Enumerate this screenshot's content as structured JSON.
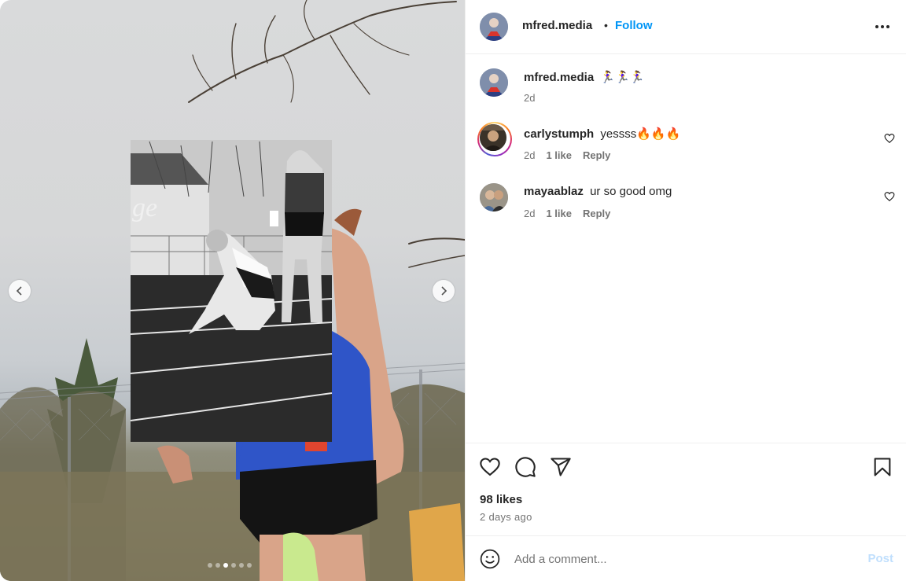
{
  "post": {
    "author": "mfred.media",
    "follow_label": "Follow",
    "separator": "•",
    "more_icon": "more-options-icon",
    "caption": {
      "username": "mfred.media",
      "text": "🏃‍♀️🏃‍♀️🏃‍♀️",
      "time": "2d"
    },
    "comments": [
      {
        "username": "carlystumph",
        "text": "yessss🔥🔥🔥",
        "time": "2d",
        "likes": "1 like",
        "reply": "Reply",
        "has_story": true
      },
      {
        "username": "mayaablaz",
        "text": "ur so good omg",
        "time": "2d",
        "likes": "1 like",
        "reply": "Reply",
        "has_story": false
      }
    ],
    "likes_label": "98 likes",
    "date_label": "2 days ago",
    "add_comment_placeholder": "Add a comment...",
    "post_label": "Post",
    "carousel": {
      "total_slides": 6,
      "active_index": 2
    }
  },
  "colors": {
    "accent": "#0095f6",
    "post_disabled": "#c0dffd",
    "text": "#262626",
    "secondary": "#737373",
    "jersey_blue": "#2f55c8"
  },
  "icons": [
    "chevron-left-icon",
    "chevron-right-icon",
    "heart-icon",
    "comment-icon",
    "share-icon",
    "bookmark-icon",
    "emoji-icon",
    "like-comment-heart-icon"
  ]
}
